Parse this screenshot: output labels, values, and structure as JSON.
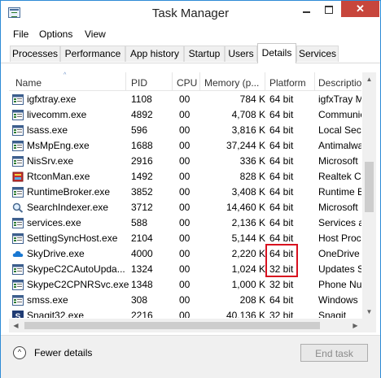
{
  "window": {
    "title": "Task Manager",
    "close_glyph": "✕"
  },
  "menu": [
    "File",
    "Options",
    "View"
  ],
  "tabs": [
    "Processes",
    "Performance",
    "App history",
    "Startup",
    "Users",
    "Details",
    "Services"
  ],
  "active_tab": "Details",
  "columns": [
    "Name",
    "PID",
    "CPU",
    "Memory (p...",
    "Platform",
    "Description"
  ],
  "sort_indicator": "^",
  "rows": [
    {
      "name": "igfxtray.exe",
      "pid": "1108",
      "cpu": "00",
      "mem": "784 K",
      "platform": "64 bit",
      "desc": "igfxTray Module",
      "icon": "app-window-icon"
    },
    {
      "name": "livecomm.exe",
      "pid": "4892",
      "cpu": "00",
      "mem": "4,708 K",
      "platform": "64 bit",
      "desc": "Communications",
      "icon": "app-window-icon"
    },
    {
      "name": "lsass.exe",
      "pid": "596",
      "cpu": "00",
      "mem": "3,816 K",
      "platform": "64 bit",
      "desc": "Local Security",
      "icon": "app-window-icon"
    },
    {
      "name": "MsMpEng.exe",
      "pid": "1688",
      "cpu": "00",
      "mem": "37,244 K",
      "platform": "64 bit",
      "desc": "Antimalware",
      "icon": "app-window-icon"
    },
    {
      "name": "NisSrv.exe",
      "pid": "2916",
      "cpu": "00",
      "mem": "336 K",
      "platform": "64 bit",
      "desc": "Microsoft",
      "icon": "app-window-icon"
    },
    {
      "name": "RtconMan.exe",
      "pid": "1492",
      "cpu": "00",
      "mem": "828 K",
      "platform": "64 bit",
      "desc": "Realtek Card",
      "icon": "realtek-icon"
    },
    {
      "name": "RuntimeBroker.exe",
      "pid": "3852",
      "cpu": "00",
      "mem": "3,408 K",
      "platform": "64 bit",
      "desc": "Runtime Broker",
      "icon": "app-window-icon"
    },
    {
      "name": "SearchIndexer.exe",
      "pid": "3712",
      "cpu": "00",
      "mem": "14,460 K",
      "platform": "64 bit",
      "desc": "Microsoft",
      "icon": "search-indexer-icon"
    },
    {
      "name": "services.exe",
      "pid": "588",
      "cpu": "00",
      "mem": "2,136 K",
      "platform": "64 bit",
      "desc": "Services and",
      "icon": "app-window-icon"
    },
    {
      "name": "SettingSyncHost.exe",
      "pid": "2104",
      "cpu": "00",
      "mem": "5,144 K",
      "platform": "64 bit",
      "desc": "Host Process",
      "icon": "app-window-icon"
    },
    {
      "name": "SkyDrive.exe",
      "pid": "4000",
      "cpu": "00",
      "mem": "2,220 K",
      "platform": "64 bit",
      "desc": "OneDrive",
      "icon": "cloud-icon"
    },
    {
      "name": "SkypeC2CAutoUpda...",
      "pid": "1324",
      "cpu": "00",
      "mem": "1,024 K",
      "platform": "32 bit",
      "desc": "Updates Skype",
      "icon": "app-window-icon"
    },
    {
      "name": "SkypeC2CPNRSvc.exe",
      "pid": "1348",
      "cpu": "00",
      "mem": "1,000 K",
      "platform": "32 bit",
      "desc": "Phone Number",
      "icon": "app-window-icon"
    },
    {
      "name": "smss.exe",
      "pid": "308",
      "cpu": "00",
      "mem": "208 K",
      "platform": "64 bit",
      "desc": "Windows",
      "icon": "app-window-icon"
    },
    {
      "name": "Snagit32.exe",
      "pid": "2216",
      "cpu": "00",
      "mem": "40,136 K",
      "platform": "32 bit",
      "desc": "Snagit",
      "icon": "snagit-icon"
    }
  ],
  "scroll_glyphs": {
    "up": "▲",
    "down": "▼",
    "left": "◀",
    "right": "▶"
  },
  "footer": {
    "fewer_details_icon": "^",
    "fewer_details_label": "Fewer details",
    "end_task_label": "End task"
  },
  "colors": {
    "highlight": "#d8101f",
    "close_button": "#c7463c",
    "window_border": "#2d8bd6"
  }
}
